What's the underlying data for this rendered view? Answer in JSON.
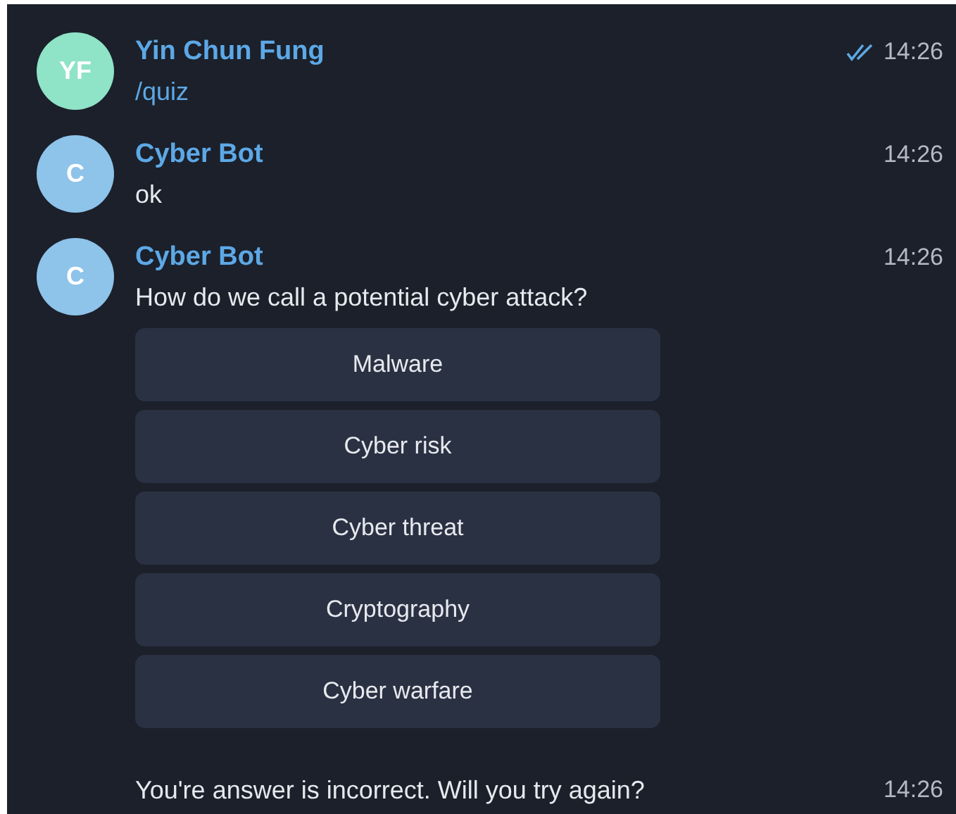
{
  "messages": [
    {
      "sender": "Yin Chun Fung",
      "avatar": {
        "initials": "YF",
        "color": "#8fe3c6"
      },
      "time": "14:26",
      "read": true,
      "kind": "command",
      "text": "/quiz"
    },
    {
      "sender": "Cyber Bot",
      "avatar": {
        "initials": "C",
        "color": "#8ec3ea"
      },
      "time": "14:26",
      "read": false,
      "kind": "text",
      "text": "ok"
    },
    {
      "sender": "Cyber Bot",
      "avatar": {
        "initials": "C",
        "color": "#8ec3ea"
      },
      "time": "14:26",
      "read": false,
      "kind": "text",
      "text": "How do we call a potential cyber attack?",
      "buttons": [
        "Malware",
        "Cyber risk",
        "Cyber threat",
        "Cryptography",
        "Cyber warfare"
      ]
    },
    {
      "time": "14:26",
      "read": false,
      "kind": "text",
      "text": "You're answer is incorrect. Will you try again?"
    }
  ]
}
